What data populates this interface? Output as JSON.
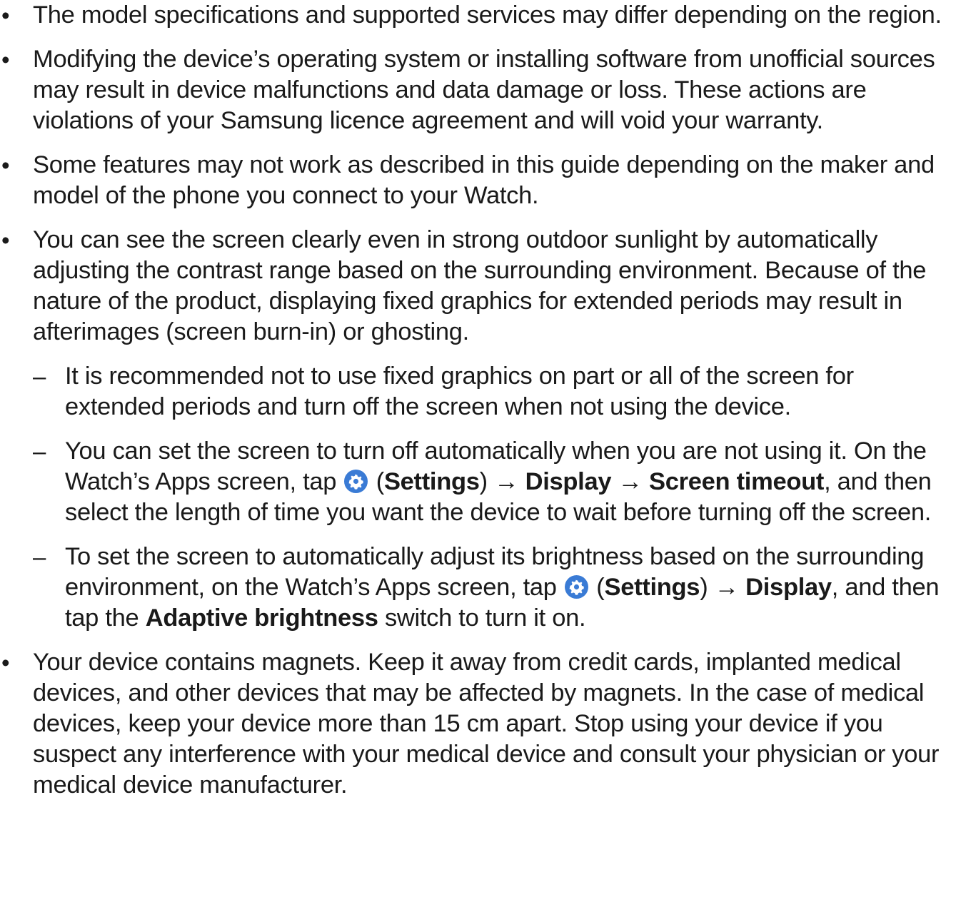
{
  "bullet_symbol": "•",
  "dash_symbol": "–",
  "items": [
    {
      "text": "The model specifications and supported services may differ depending on the region."
    },
    {
      "text": "Modifying the device’s operating system or installing software from unofficial sources may result in device malfunctions and data damage or loss. These actions are violations of your Samsung licence agreement and will void your warranty."
    },
    {
      "text": "Some features may not work as described in this guide depending on the maker and model of the phone you connect to your Watch."
    },
    {
      "text": "You can see the screen clearly even in strong outdoor sunlight by automatically adjusting the contrast range based on the surrounding environment. Because of the nature of the product, displaying fixed graphics for extended periods may result in afterimages (screen burn-in) or ghosting."
    },
    {
      "text": "Your device contains magnets. Keep it away from credit cards, implanted medical devices, and other devices that may be affected by magnets. In the case of medical devices, keep your device more than 15 cm apart. Stop using your device if you suspect any interference with your medical device and consult your physician or your medical device manufacturer."
    }
  ],
  "subitems": {
    "fixed_graphics": "It is recommended not to use fixed graphics on part or all of the screen for extended periods and turn off the screen when not using the device.",
    "timeout": {
      "part1": "You can set the screen to turn off automatically when you are not using it. On the Watch’s Apps screen, tap",
      "open_paren": " (",
      "settings": "Settings",
      "arrow1": ") → ",
      "display": "Display",
      "arrow2": " → ",
      "screen_timeout": "Screen timeout",
      "part2": ", and then select the length of time you want the device to wait before turning off the screen."
    },
    "brightness": {
      "part1": "To set the screen to automatically adjust its brightness based on the surrounding environment, on the Watch’s Apps screen, tap",
      "open_paren": " (",
      "settings": "Settings",
      "arrow1": ") → ",
      "display": "Display",
      "part2": ", and then tap the ",
      "adaptive": "Adaptive brightness",
      "part3": " switch to turn it on."
    }
  },
  "icons": {
    "settings": "settings-gear-icon"
  },
  "colors": {
    "text": "#1a1a1a",
    "gear": "#3a7bd5"
  }
}
